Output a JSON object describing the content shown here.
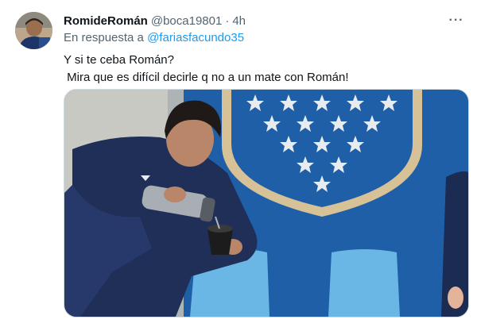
{
  "tweet": {
    "display_name": "RomideRomán",
    "handle": "@boca19801",
    "separator": "·",
    "time": "4h",
    "reply_prefix": "En respuesta a",
    "reply_to": "@fariasfacundo35",
    "text": "Y si te ceba Román?\n Mira que es difícil decirle q no a un mate con Román!",
    "more_icon": "more-icon"
  },
  "colors": {
    "link": "#1d9bf0",
    "secondary_text": "#536471",
    "badge_blue": "#1f5fa8",
    "badge_gold": "#d7c297"
  }
}
